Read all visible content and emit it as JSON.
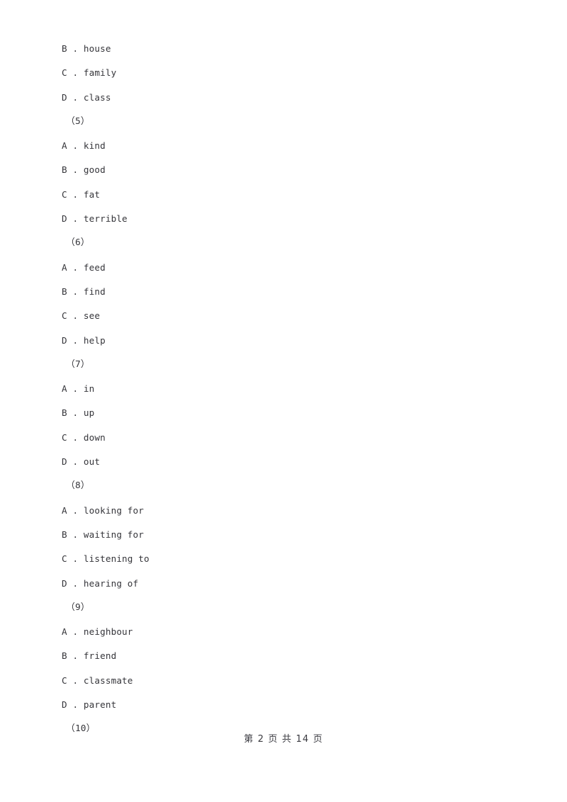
{
  "document": {
    "page_background": "#ffffff",
    "text_color": "#35353a",
    "lines": [
      {
        "kind": "option",
        "text": "B . house"
      },
      {
        "kind": "option",
        "text": "C . family"
      },
      {
        "kind": "option",
        "text": "D . class"
      },
      {
        "kind": "qnum",
        "text": "（5）"
      },
      {
        "kind": "option",
        "text": "A . kind"
      },
      {
        "kind": "option",
        "text": "B . good"
      },
      {
        "kind": "option",
        "text": "C . fat"
      },
      {
        "kind": "option",
        "text": "D . terrible"
      },
      {
        "kind": "qnum",
        "text": "（6）"
      },
      {
        "kind": "option",
        "text": "A . feed"
      },
      {
        "kind": "option",
        "text": "B . find"
      },
      {
        "kind": "option",
        "text": "C . see"
      },
      {
        "kind": "option",
        "text": "D . help"
      },
      {
        "kind": "qnum",
        "text": "（7）"
      },
      {
        "kind": "option",
        "text": "A . in"
      },
      {
        "kind": "option",
        "text": "B . up"
      },
      {
        "kind": "option",
        "text": "C . down"
      },
      {
        "kind": "option",
        "text": "D . out"
      },
      {
        "kind": "qnum",
        "text": "（8）"
      },
      {
        "kind": "option",
        "text": "A . looking for"
      },
      {
        "kind": "option",
        "text": "B . waiting for"
      },
      {
        "kind": "option",
        "text": "C . listening to"
      },
      {
        "kind": "option",
        "text": "D . hearing of"
      },
      {
        "kind": "qnum",
        "text": "（9）"
      },
      {
        "kind": "option",
        "text": "A . neighbour"
      },
      {
        "kind": "option",
        "text": "B . friend"
      },
      {
        "kind": "option",
        "text": "C . classmate"
      },
      {
        "kind": "option",
        "text": "D . parent"
      },
      {
        "kind": "qnum",
        "text": "（10）"
      }
    ]
  },
  "footer": {
    "text": "第 2 页 共 14 页",
    "current_page": "2",
    "total_pages": "14"
  }
}
